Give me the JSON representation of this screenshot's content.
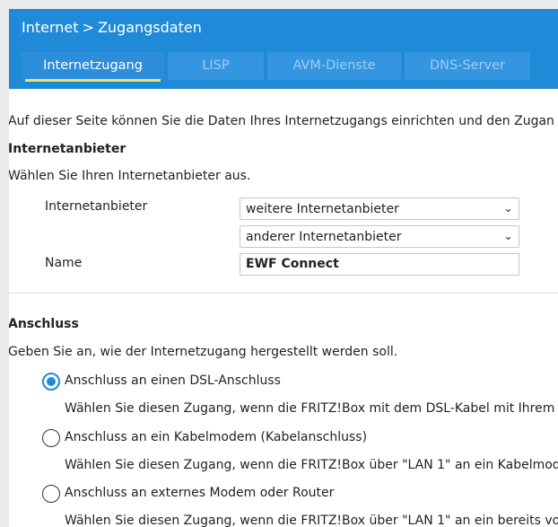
{
  "header": {
    "breadcrumb": [
      "Internet",
      ">",
      "Zugangsdaten"
    ],
    "tabs": [
      {
        "label": "Internetzugang",
        "active": true
      },
      {
        "label": "LISP",
        "active": false
      },
      {
        "label": "AVM-Dienste",
        "active": false
      },
      {
        "label": "DNS-Server",
        "active": false
      }
    ]
  },
  "content": {
    "intro": "Auf dieser Seite können Sie die Daten Ihres Internetzugangs einrichten und den Zugan",
    "provider_section": {
      "heading": "Internetanbieter",
      "description": "Wählen Sie Ihren Internetanbieter aus.",
      "provider_label": "Internetanbieter",
      "provider_select_1": "weitere Internetanbieter",
      "provider_select_2": "anderer Internetanbieter",
      "name_label": "Name",
      "name_value": "EWF Connect"
    },
    "connection_section": {
      "heading": "Anschluss",
      "description": "Geben Sie an, wie der Internetzugang hergestellt werden soll.",
      "options": [
        {
          "label": "Anschluss an einen DSL-Anschluss",
          "description": "Wählen Sie diesen Zugang, wenn die FRITZ!Box mit dem DSL-Kabel mit Ihrem D",
          "checked": true
        },
        {
          "label": "Anschluss an ein Kabelmodem (Kabelanschluss)",
          "description": "Wählen Sie diesen Zugang, wenn die FRITZ!Box über \"LAN 1\" an ein Kabelmode",
          "checked": false
        },
        {
          "label": "Anschluss an externes Modem oder Router",
          "description": "Wählen Sie diesen Zugang, wenn die FRITZ!Box über \"LAN 1\" an ein bereits vorh",
          "checked": false
        }
      ]
    }
  },
  "colors": {
    "header_bg": "#1f8ad8",
    "accent": "#f2e16b"
  },
  "icons": {
    "chevron": "chevron-down-icon",
    "radio": "radio-icon"
  }
}
